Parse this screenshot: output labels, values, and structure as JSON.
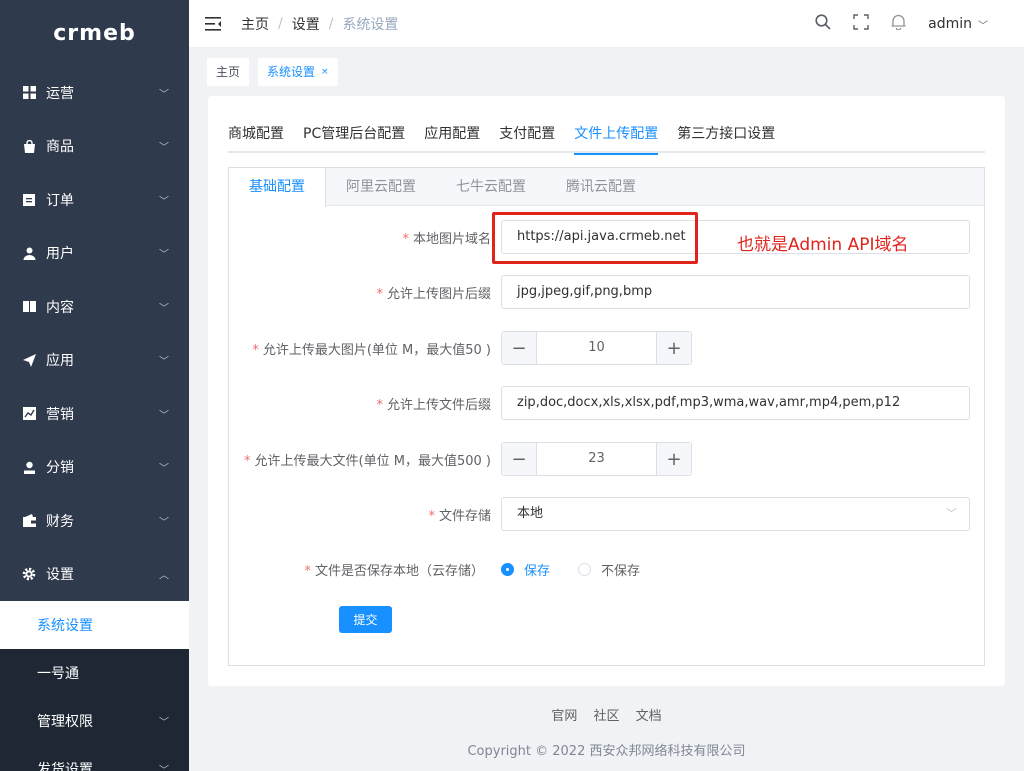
{
  "logo": "crmeb",
  "sidebar": {
    "items": [
      {
        "label": "运营",
        "icon": "grid-icon"
      },
      {
        "label": "商品",
        "icon": "bag-icon"
      },
      {
        "label": "订单",
        "icon": "clipboard-icon"
      },
      {
        "label": "用户",
        "icon": "user-icon"
      },
      {
        "label": "内容",
        "icon": "book-icon"
      },
      {
        "label": "应用",
        "icon": "send-icon"
      },
      {
        "label": "营销",
        "icon": "chart-icon"
      },
      {
        "label": "分销",
        "icon": "person-icon"
      },
      {
        "label": "财务",
        "icon": "wallet-icon"
      },
      {
        "label": "设置",
        "icon": "gear-icon"
      }
    ],
    "sub": [
      "系统设置",
      "一号通",
      "管理权限",
      "发货设置"
    ]
  },
  "header": {
    "breadcrumb": [
      "主页",
      "设置",
      "系统设置"
    ],
    "user": "admin"
  },
  "tags": {
    "home": "主页",
    "current": "系统设置",
    "close": "×"
  },
  "tabs": [
    "商城配置",
    "PC管理后台配置",
    "应用配置",
    "支付配置",
    "文件上传配置",
    "第三方接口设置"
  ],
  "inner_tabs": [
    "基础配置",
    "阿里云配置",
    "七牛云配置",
    "腾讯云配置"
  ],
  "form": {
    "required": "*",
    "domain_label": "本地图片域名",
    "domain_value": "https://api.java.crmeb.net",
    "img_ext_label": "允许上传图片后缀",
    "img_ext_value": "jpg,jpeg,gif,png,bmp",
    "img_max_label": "允许上传最大图片(单位 M，最大值50 )",
    "img_max_value": "10",
    "file_ext_label": "允许上传文件后缀",
    "file_ext_value": "zip,doc,docx,xls,xlsx,pdf,mp3,wma,wav,amr,mp4,pem,p12",
    "file_max_label": "允许上传最大文件(单位 M，最大值500 )",
    "file_max_value": "23",
    "storage_label": "文件存储",
    "storage_value": "本地",
    "save_local_label": "文件是否保存本地（云存储）",
    "radio_yes": "保存",
    "radio_no": "不保存",
    "submit": "提交",
    "minus": "−",
    "plus": "+"
  },
  "annotation": "也就是Admin API域名",
  "footer": {
    "links": [
      "官网",
      "社区",
      "文档"
    ],
    "copyright": "Copyright © 2022 西安众邦网络科技有限公司"
  },
  "colors": {
    "accent": "#1890ff",
    "sidebar": "#2f3a4c",
    "annotation": "#e0241b"
  }
}
